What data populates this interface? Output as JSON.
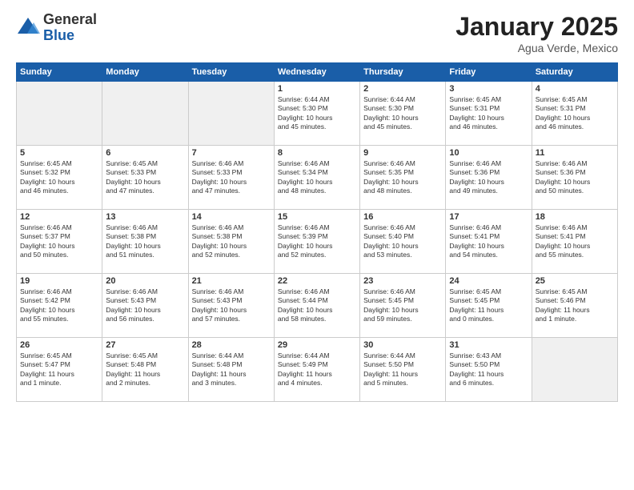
{
  "logo": {
    "general": "General",
    "blue": "Blue"
  },
  "title": "January 2025",
  "location": "Agua Verde, Mexico",
  "days_header": [
    "Sunday",
    "Monday",
    "Tuesday",
    "Wednesday",
    "Thursday",
    "Friday",
    "Saturday"
  ],
  "weeks": [
    [
      {
        "day": "",
        "text": ""
      },
      {
        "day": "",
        "text": ""
      },
      {
        "day": "",
        "text": ""
      },
      {
        "day": "1",
        "text": "Sunrise: 6:44 AM\nSunset: 5:30 PM\nDaylight: 10 hours\nand 45 minutes."
      },
      {
        "day": "2",
        "text": "Sunrise: 6:44 AM\nSunset: 5:30 PM\nDaylight: 10 hours\nand 45 minutes."
      },
      {
        "day": "3",
        "text": "Sunrise: 6:45 AM\nSunset: 5:31 PM\nDaylight: 10 hours\nand 46 minutes."
      },
      {
        "day": "4",
        "text": "Sunrise: 6:45 AM\nSunset: 5:31 PM\nDaylight: 10 hours\nand 46 minutes."
      }
    ],
    [
      {
        "day": "5",
        "text": "Sunrise: 6:45 AM\nSunset: 5:32 PM\nDaylight: 10 hours\nand 46 minutes."
      },
      {
        "day": "6",
        "text": "Sunrise: 6:45 AM\nSunset: 5:33 PM\nDaylight: 10 hours\nand 47 minutes."
      },
      {
        "day": "7",
        "text": "Sunrise: 6:46 AM\nSunset: 5:33 PM\nDaylight: 10 hours\nand 47 minutes."
      },
      {
        "day": "8",
        "text": "Sunrise: 6:46 AM\nSunset: 5:34 PM\nDaylight: 10 hours\nand 48 minutes."
      },
      {
        "day": "9",
        "text": "Sunrise: 6:46 AM\nSunset: 5:35 PM\nDaylight: 10 hours\nand 48 minutes."
      },
      {
        "day": "10",
        "text": "Sunrise: 6:46 AM\nSunset: 5:36 PM\nDaylight: 10 hours\nand 49 minutes."
      },
      {
        "day": "11",
        "text": "Sunrise: 6:46 AM\nSunset: 5:36 PM\nDaylight: 10 hours\nand 50 minutes."
      }
    ],
    [
      {
        "day": "12",
        "text": "Sunrise: 6:46 AM\nSunset: 5:37 PM\nDaylight: 10 hours\nand 50 minutes."
      },
      {
        "day": "13",
        "text": "Sunrise: 6:46 AM\nSunset: 5:38 PM\nDaylight: 10 hours\nand 51 minutes."
      },
      {
        "day": "14",
        "text": "Sunrise: 6:46 AM\nSunset: 5:38 PM\nDaylight: 10 hours\nand 52 minutes."
      },
      {
        "day": "15",
        "text": "Sunrise: 6:46 AM\nSunset: 5:39 PM\nDaylight: 10 hours\nand 52 minutes."
      },
      {
        "day": "16",
        "text": "Sunrise: 6:46 AM\nSunset: 5:40 PM\nDaylight: 10 hours\nand 53 minutes."
      },
      {
        "day": "17",
        "text": "Sunrise: 6:46 AM\nSunset: 5:41 PM\nDaylight: 10 hours\nand 54 minutes."
      },
      {
        "day": "18",
        "text": "Sunrise: 6:46 AM\nSunset: 5:41 PM\nDaylight: 10 hours\nand 55 minutes."
      }
    ],
    [
      {
        "day": "19",
        "text": "Sunrise: 6:46 AM\nSunset: 5:42 PM\nDaylight: 10 hours\nand 55 minutes."
      },
      {
        "day": "20",
        "text": "Sunrise: 6:46 AM\nSunset: 5:43 PM\nDaylight: 10 hours\nand 56 minutes."
      },
      {
        "day": "21",
        "text": "Sunrise: 6:46 AM\nSunset: 5:43 PM\nDaylight: 10 hours\nand 57 minutes."
      },
      {
        "day": "22",
        "text": "Sunrise: 6:46 AM\nSunset: 5:44 PM\nDaylight: 10 hours\nand 58 minutes."
      },
      {
        "day": "23",
        "text": "Sunrise: 6:46 AM\nSunset: 5:45 PM\nDaylight: 10 hours\nand 59 minutes."
      },
      {
        "day": "24",
        "text": "Sunrise: 6:45 AM\nSunset: 5:45 PM\nDaylight: 11 hours\nand 0 minutes."
      },
      {
        "day": "25",
        "text": "Sunrise: 6:45 AM\nSunset: 5:46 PM\nDaylight: 11 hours\nand 1 minute."
      }
    ],
    [
      {
        "day": "26",
        "text": "Sunrise: 6:45 AM\nSunset: 5:47 PM\nDaylight: 11 hours\nand 1 minute."
      },
      {
        "day": "27",
        "text": "Sunrise: 6:45 AM\nSunset: 5:48 PM\nDaylight: 11 hours\nand 2 minutes."
      },
      {
        "day": "28",
        "text": "Sunrise: 6:44 AM\nSunset: 5:48 PM\nDaylight: 11 hours\nand 3 minutes."
      },
      {
        "day": "29",
        "text": "Sunrise: 6:44 AM\nSunset: 5:49 PM\nDaylight: 11 hours\nand 4 minutes."
      },
      {
        "day": "30",
        "text": "Sunrise: 6:44 AM\nSunset: 5:50 PM\nDaylight: 11 hours\nand 5 minutes."
      },
      {
        "day": "31",
        "text": "Sunrise: 6:43 AM\nSunset: 5:50 PM\nDaylight: 11 hours\nand 6 minutes."
      },
      {
        "day": "",
        "text": ""
      }
    ]
  ]
}
